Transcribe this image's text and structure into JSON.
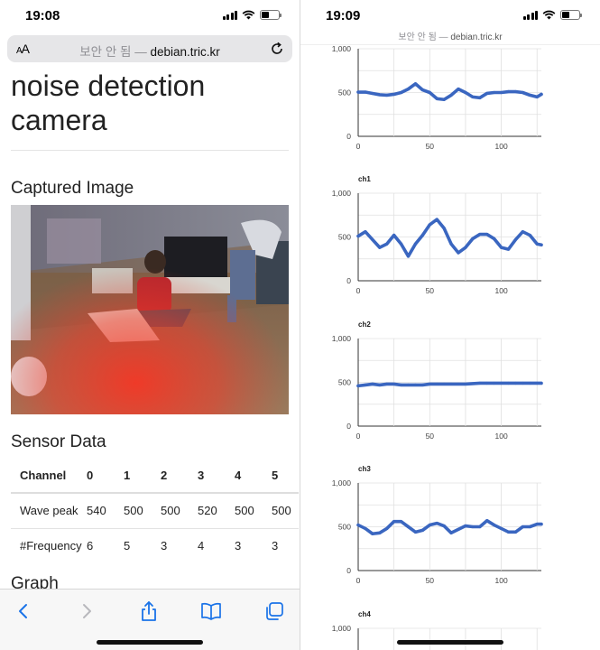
{
  "status": {
    "left_time": "19:08",
    "right_time": "19:09"
  },
  "browser": {
    "aa_label": "AA",
    "url_insecure": "보안 안 됨",
    "url_sep": " — ",
    "url_host": "debian.tric.kr"
  },
  "page": {
    "title": "noise detection camera",
    "captured_heading": "Captured Image",
    "sensor_heading": "Sensor Data",
    "graph_heading": "Graph"
  },
  "sensor_table": {
    "headers": [
      "Channel",
      "0",
      "1",
      "2",
      "3",
      "4",
      "5"
    ],
    "rows": [
      {
        "label": "Wave peak",
        "values": [
          "540",
          "500",
          "500",
          "520",
          "500",
          "500"
        ]
      },
      {
        "label": "#Frequency",
        "values": [
          "6",
          "5",
          "3",
          "4",
          "3",
          "3"
        ]
      }
    ]
  },
  "colors": {
    "series": "#3a66c0",
    "grid": "#e0e0e0",
    "axis": "#333333"
  },
  "chart_data": [
    {
      "type": "line",
      "title": "",
      "x": [
        0,
        5,
        10,
        15,
        20,
        25,
        30,
        35,
        40,
        45,
        50,
        55,
        60,
        65,
        70,
        75,
        80,
        85,
        90,
        95,
        100,
        105,
        110,
        115,
        120,
        125,
        128
      ],
      "series": [
        {
          "values": [
            505,
            505,
            490,
            475,
            470,
            480,
            500,
            540,
            600,
            530,
            500,
            430,
            420,
            470,
            540,
            500,
            450,
            440,
            490,
            500,
            500,
            510,
            510,
            500,
            470,
            450,
            480
          ]
        }
      ],
      "yticks": [
        "0",
        "500",
        "1,000"
      ],
      "xticks": [
        "0",
        "50",
        "100"
      ],
      "ylim": [
        0,
        1000
      ],
      "xlim": [
        0,
        128
      ]
    },
    {
      "type": "line",
      "title": "ch1",
      "x": [
        0,
        5,
        10,
        15,
        20,
        25,
        30,
        35,
        40,
        45,
        50,
        55,
        60,
        65,
        70,
        75,
        80,
        85,
        90,
        95,
        100,
        105,
        110,
        115,
        120,
        125,
        128
      ],
      "series": [
        {
          "values": [
            510,
            560,
            470,
            380,
            420,
            520,
            420,
            280,
            420,
            520,
            640,
            700,
            600,
            420,
            320,
            380,
            480,
            530,
            530,
            480,
            380,
            360,
            470,
            560,
            520,
            420,
            410
          ]
        }
      ],
      "yticks": [
        "0",
        "500",
        "1,000"
      ],
      "xticks": [
        "0",
        "50",
        "100"
      ],
      "ylim": [
        0,
        1000
      ],
      "xlim": [
        0,
        128
      ]
    },
    {
      "type": "line",
      "title": "ch2",
      "x": [
        0,
        5,
        10,
        15,
        20,
        25,
        30,
        35,
        40,
        45,
        50,
        55,
        60,
        65,
        70,
        75,
        80,
        85,
        90,
        95,
        100,
        105,
        110,
        115,
        120,
        125,
        128
      ],
      "series": [
        {
          "values": [
            460,
            470,
            480,
            470,
            480,
            480,
            470,
            470,
            470,
            470,
            480,
            480,
            480,
            480,
            480,
            480,
            485,
            490,
            490,
            490,
            490,
            490,
            490,
            490,
            490,
            490,
            490
          ]
        }
      ],
      "yticks": [
        "0",
        "500",
        "1,000"
      ],
      "xticks": [
        "0",
        "50",
        "100"
      ],
      "ylim": [
        0,
        1000
      ],
      "xlim": [
        0,
        128
      ]
    },
    {
      "type": "line",
      "title": "ch3",
      "x": [
        0,
        5,
        10,
        15,
        20,
        25,
        30,
        35,
        40,
        45,
        50,
        55,
        60,
        65,
        70,
        75,
        80,
        85,
        90,
        95,
        100,
        105,
        110,
        115,
        120,
        125,
        128
      ],
      "series": [
        {
          "values": [
            520,
            480,
            420,
            430,
            480,
            560,
            560,
            500,
            440,
            460,
            520,
            540,
            510,
            430,
            470,
            510,
            500,
            500,
            570,
            520,
            480,
            440,
            440,
            500,
            500,
            530,
            530
          ]
        }
      ],
      "yticks": [
        "0",
        "500",
        "1,000"
      ],
      "xticks": [
        "0",
        "50",
        "100"
      ],
      "ylim": [
        0,
        1000
      ],
      "xlim": [
        0,
        128
      ]
    },
    {
      "type": "line",
      "title": "ch4",
      "x": [],
      "series": [
        {
          "values": []
        }
      ],
      "yticks": [
        "1,000"
      ],
      "xticks": [],
      "ylim": [
        0,
        1000
      ],
      "xlim": [
        0,
        128
      ]
    }
  ]
}
